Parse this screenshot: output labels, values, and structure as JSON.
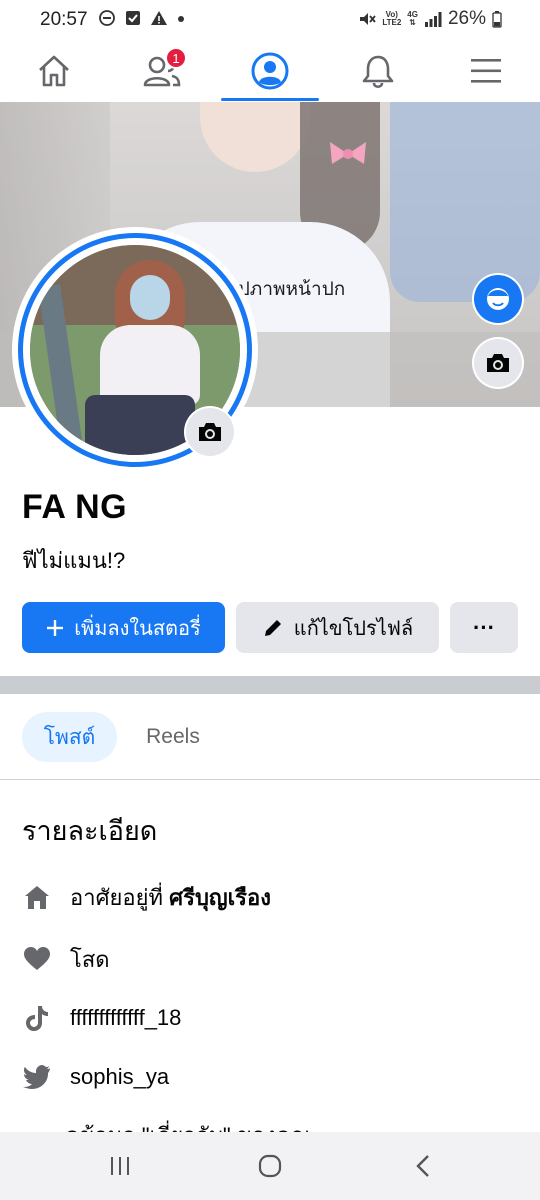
{
  "status_bar": {
    "time": "20:57",
    "network_top": "Vo)",
    "network_bottom": "LTE2",
    "net2_top": "4G",
    "battery": "26%"
  },
  "nav": {
    "items": [
      {
        "icon": "home-icon"
      },
      {
        "icon": "friends-icon",
        "badge": "1"
      },
      {
        "icon": "profile-icon"
      },
      {
        "icon": "bell-icon"
      },
      {
        "icon": "menu-icon"
      }
    ],
    "active_index": 2,
    "accent": "#1877f2",
    "badge_color": "#e41e3f"
  },
  "cover": {
    "add_cover_label": "เพิ่มรูปภาพหน้าปก"
  },
  "profile": {
    "name": "FA NG",
    "bio": "ฟีไม่แมน!?"
  },
  "actions": {
    "add_story": "เพิ่มลงในสตอรี่",
    "edit_profile": "แก้ไขโปรไฟล์",
    "more": "···"
  },
  "tabs": {
    "posts": "โพสต์",
    "reels": "Reels"
  },
  "details": {
    "title": "รายละเอียด",
    "lives_prefix": "อาศัยอยู่ที่",
    "lives_place": "ศรีบุญเรือง",
    "relationship": "โสด",
    "tiktok": "fffffffffffff_18",
    "twitter": "sophis_ya",
    "cut_text": "ดูข้อมูล \"เกี่ยวกับ\" ของคุณ"
  }
}
